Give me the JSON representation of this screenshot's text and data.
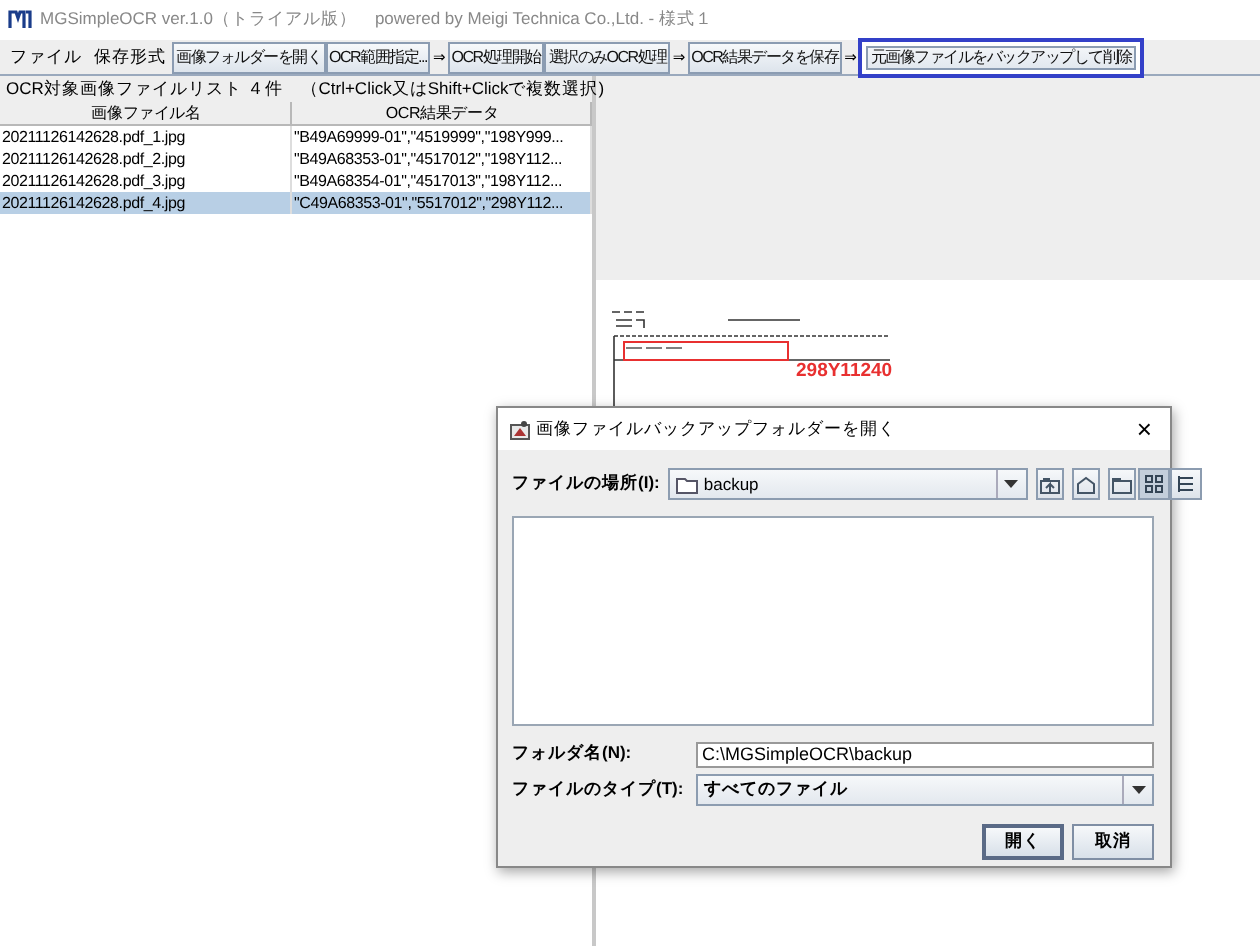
{
  "window": {
    "title": "MGSimpleOCR ver.1.0（トライアル版）　powered by Meigi Technica Co.,Ltd. - 様式１"
  },
  "menu": [
    "ファイル",
    "保存形式"
  ],
  "toolbar": [
    {
      "kind": "button",
      "label": "画像フォルダーを開く",
      "highlighted": false
    },
    {
      "kind": "button",
      "label": "OCR範囲指定...",
      "highlighted": false
    },
    {
      "kind": "arrow",
      "label": "⇒"
    },
    {
      "kind": "button",
      "label": "OCR処理開始",
      "highlighted": false
    },
    {
      "kind": "button",
      "label": "選択のみOCR処理",
      "highlighted": false
    },
    {
      "kind": "arrow",
      "label": "⇒"
    },
    {
      "kind": "button",
      "label": "OCR結果データを保存",
      "highlighted": false
    },
    {
      "kind": "arrow",
      "label": "⇒"
    },
    {
      "kind": "button",
      "label": "元画像ファイルをバックアップして削除",
      "highlighted": true
    }
  ],
  "file_list": {
    "caption": "OCR対象画像ファイルリスト ４件　（Ctrl+Click又はShift+Clickで複数選択)",
    "columns": [
      "画像ファイル名",
      "OCR結果データ"
    ],
    "rows": [
      {
        "cells": [
          "20211126142628.pdf_1.jpg",
          "\"B49A69999-01\",\"4519999\",\"198Y999..."
        ],
        "selected": false
      },
      {
        "cells": [
          "20211126142628.pdf_2.jpg",
          "\"B49A68353-01\",\"4517012\",\"198Y112..."
        ],
        "selected": false
      },
      {
        "cells": [
          "20211126142628.pdf_3.jpg",
          "\"B49A68354-01\",\"4517013\",\"198Y112..."
        ],
        "selected": false
      },
      {
        "cells": [
          "20211126142628.pdf_4.jpg",
          "\"C49A68353-01\",\"5517012\",\"298Y112..."
        ],
        "selected": true
      }
    ]
  },
  "preview": {
    "ocr_label": "298Y11240"
  },
  "dialog": {
    "title": "画像ファイルバックアップフォルダーを開く",
    "close": "×",
    "location_label": "ファイルの場所(I):",
    "location": "backup",
    "view_modes": [
      {
        "kind": "list",
        "selected": true
      },
      {
        "kind": "details",
        "selected": false
      }
    ],
    "folder_label": "フォルダ名(N):",
    "folder": "C:\\MGSimpleOCR\\backup",
    "type_label": "ファイルのタイプ(T):",
    "type": "すべてのファイル",
    "buttons": [
      "開く",
      "取消"
    ]
  }
}
